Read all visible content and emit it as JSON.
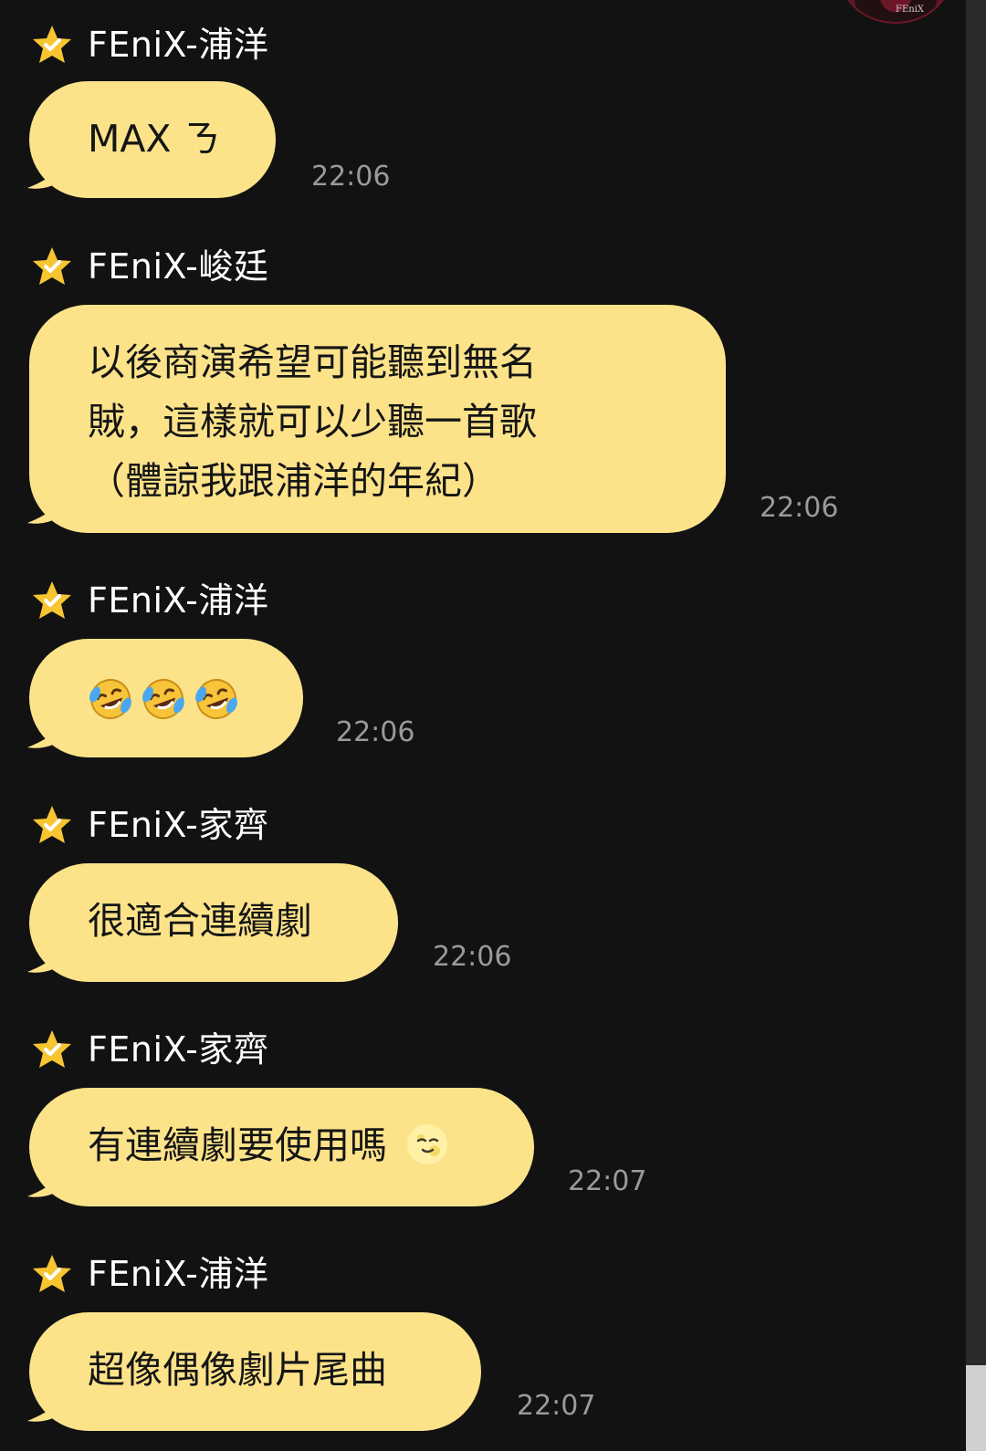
{
  "avatar": {
    "label": "FEniX"
  },
  "messages": [
    {
      "sender": "FEniX-浦洋",
      "text": "MAX ㄋ",
      "time": "22:06"
    },
    {
      "sender": "FEniX-峻廷",
      "lines": [
        "以後商演希望可能聽到無名",
        "賊，這樣就可以少聽一首歌",
        "（體諒我跟浦洋的年紀）"
      ],
      "time": "22:06"
    },
    {
      "sender": "FEniX-浦洋",
      "emojis": [
        "🤣",
        "🤣",
        "🤣"
      ],
      "time": "22:06"
    },
    {
      "sender": "FEniX-家齊",
      "text": "很適合連續劇",
      "time": "22:06"
    },
    {
      "sender": "FEniX-家齊",
      "text": "有連續劇要使用嗎",
      "emoji": "🌝",
      "time": "22:07"
    },
    {
      "sender": "FEniX-浦洋",
      "text": "超像偶像劇片尾曲",
      "time": "22:07"
    }
  ],
  "colors": {
    "background": "#121212",
    "bubble": "#fce38a",
    "star": "#f7c531",
    "time": "#9a9a9a",
    "name": "#ffffff"
  },
  "icons": {
    "sender_badge": "star-check-icon",
    "emoji_laugh": "rolling-laughing-emoji",
    "emoji_moon": "full-moon-face-emoji"
  }
}
